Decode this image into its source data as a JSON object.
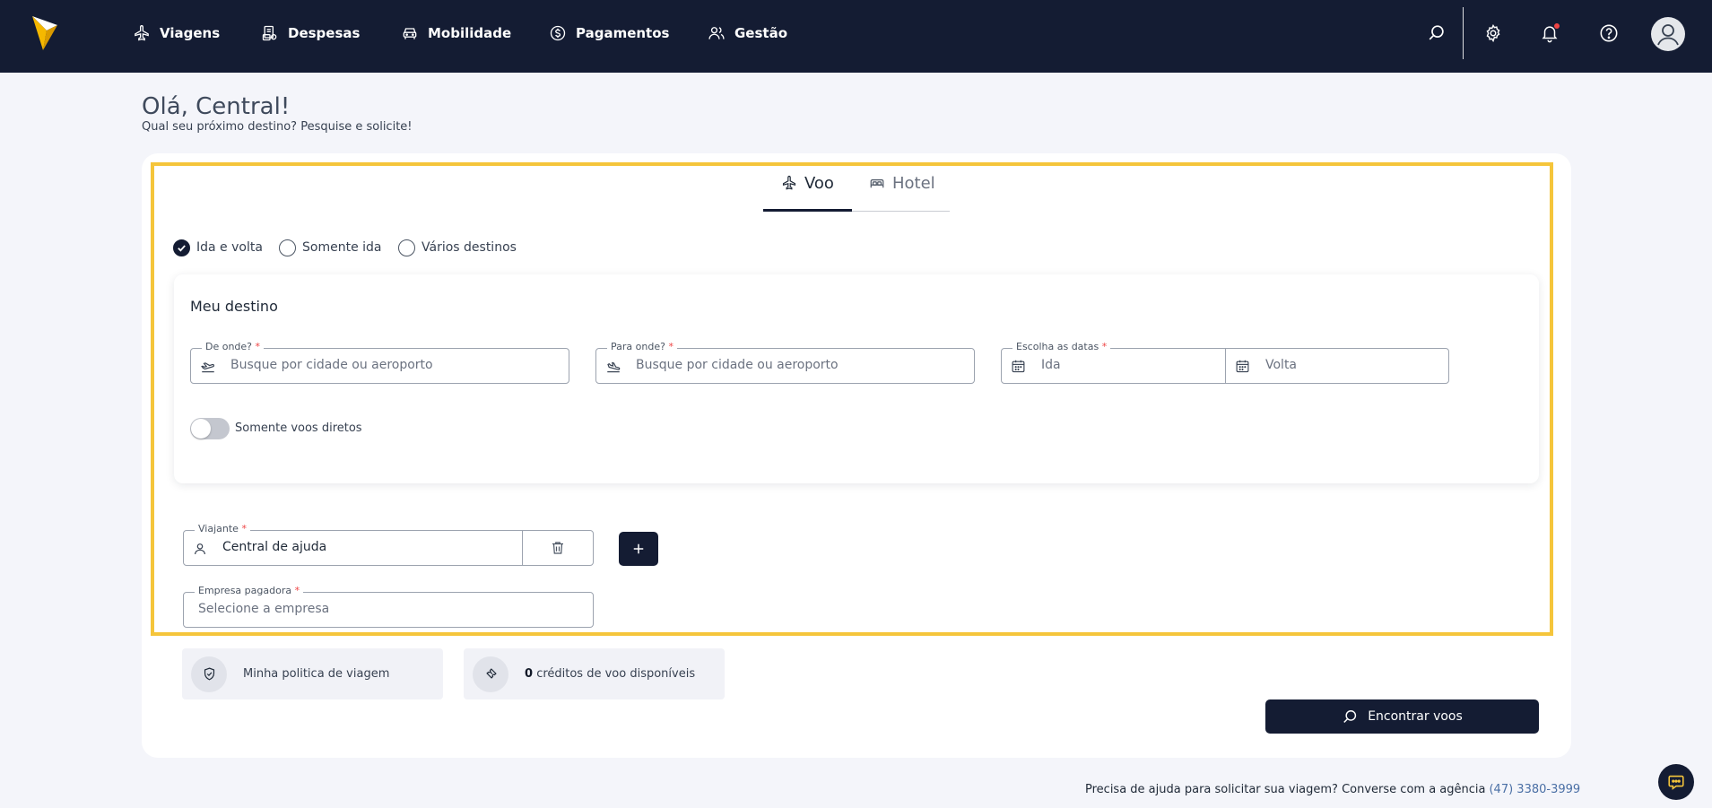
{
  "nav": {
    "items": [
      {
        "label": "Viagens",
        "icon": "plane-icon"
      },
      {
        "label": "Despesas",
        "icon": "receipt-icon"
      },
      {
        "label": "Mobilidade",
        "icon": "car-icon"
      },
      {
        "label": "Pagamentos",
        "icon": "dollar-circle-icon"
      },
      {
        "label": "Gestão",
        "icon": "users-icon"
      }
    ],
    "icons": [
      "search-icon",
      "gear-icon",
      "bell-icon",
      "help-circle-icon",
      "avatar"
    ]
  },
  "header": {
    "greeting": "Olá, Central!",
    "subtitle": "Qual seu próximo destino? Pesquise e solicite!"
  },
  "tabs": {
    "voo": "Voo",
    "hotel": "Hotel",
    "active": "Voo"
  },
  "trip_type": {
    "options": [
      "Ida e volta",
      "Somente ida",
      "Vários destinos"
    ],
    "selected": "Ida e volta"
  },
  "destination": {
    "title": "Meu destino",
    "origin": {
      "label": "De onde?",
      "required": "*",
      "placeholder": "Busque por cidade ou aeroporto"
    },
    "destination": {
      "label": "Para onde?",
      "required": "*",
      "placeholder": "Busque por cidade ou aeroporto"
    },
    "dates": {
      "label": "Escolha as datas",
      "required": "*",
      "departure_placeholder": "Ida",
      "return_placeholder": "Volta"
    },
    "direct_only": {
      "label": "Somente voos diretos",
      "enabled": false
    }
  },
  "traveler": {
    "label": "Viajante",
    "required": "*",
    "value": "Central de ajuda"
  },
  "company": {
    "label": "Empresa pagadora",
    "required": "*",
    "placeholder": "Selecione a empresa"
  },
  "info": {
    "policy": "Minha politica de viagem",
    "credits_count": "0",
    "credits_text": "créditos de voo disponíveis"
  },
  "search_button": "Encontrar voos",
  "footer": {
    "help_text": "Precisa de ajuda para solicitar sua viagem? Converse com a agência",
    "phone": "(47) 3380-3999"
  },
  "colors": {
    "navy": "#141c33",
    "highlight": "#f5c53b",
    "logo_yellow": "#f5b800",
    "required": "#ef4444"
  }
}
